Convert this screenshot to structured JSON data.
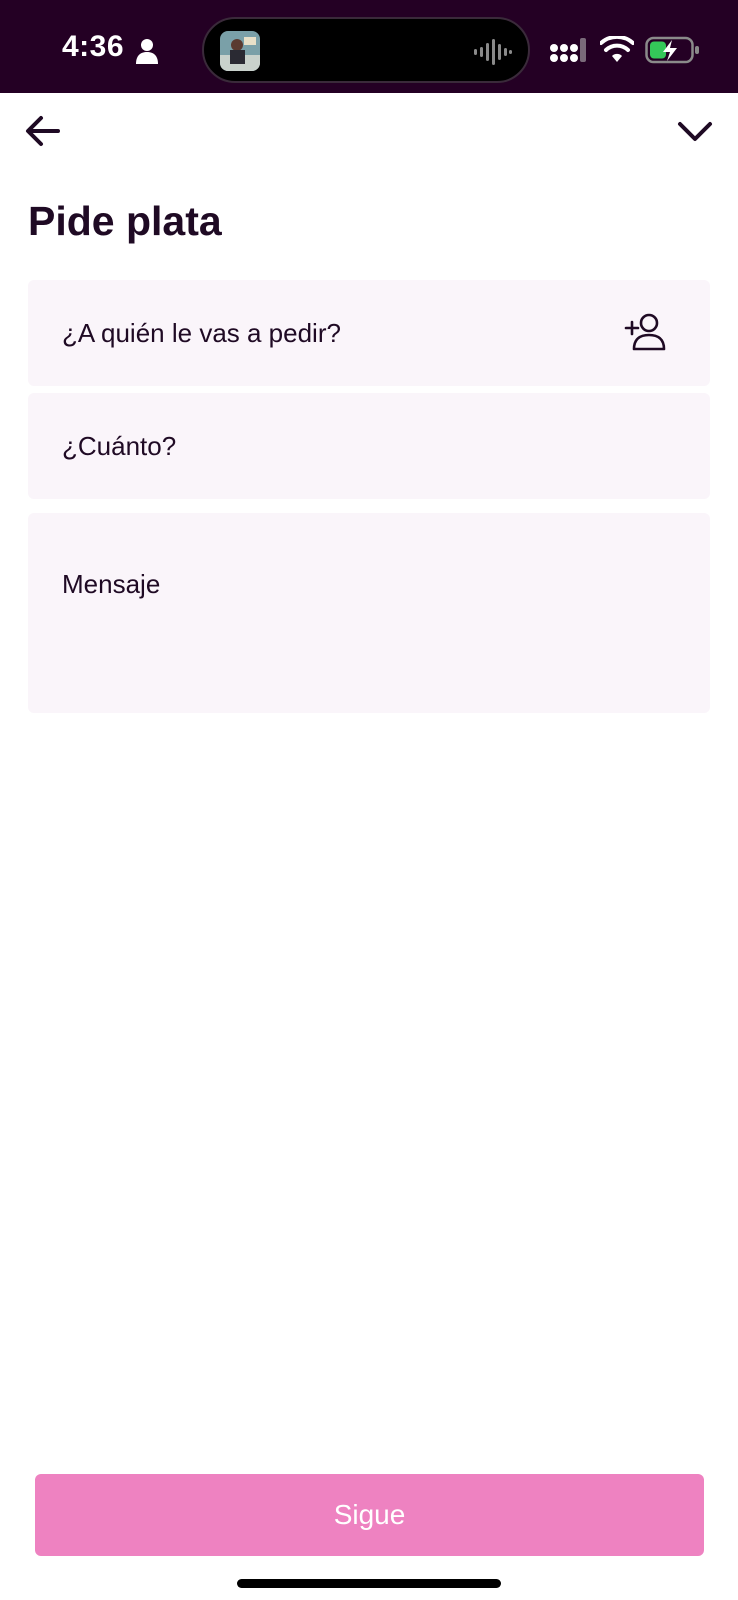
{
  "status_bar": {
    "time": "4:36",
    "icons": [
      "person-icon",
      "now-playing-art",
      "waveform-icon",
      "signal-icon",
      "wifi-icon",
      "battery-charging-icon"
    ],
    "background": "#240024"
  },
  "nav": {
    "back_icon": "arrow-left-icon",
    "collapse_icon": "chevron-down-icon"
  },
  "page": {
    "title": "Pide plata"
  },
  "form": {
    "recipient_placeholder": "¿A quién le vas a pedir?",
    "recipient_icon": "add-contact-icon",
    "amount_placeholder": "¿Cuánto?",
    "message_placeholder": "Mensaje",
    "field_background": "#faf5fa"
  },
  "actions": {
    "continue_label": "Sigue",
    "continue_color": "#ee82c1"
  }
}
